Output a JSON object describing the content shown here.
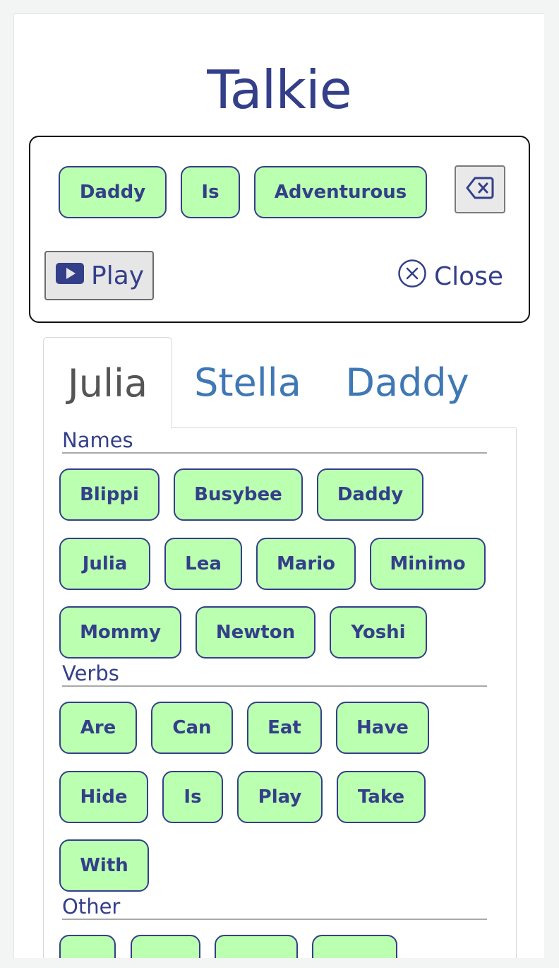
{
  "app": {
    "title": "Talkie"
  },
  "sentence": {
    "words": [
      "Daddy",
      "Is",
      "Adventurous"
    ],
    "backspace_icon": "backspace-icon",
    "play_label": "Play",
    "play_icon": "play-icon",
    "close_label": "Close",
    "close_icon": "close-circle-icon"
  },
  "tabs": [
    {
      "label": "Julia",
      "active": true
    },
    {
      "label": "Stella",
      "active": false
    },
    {
      "label": "Daddy",
      "active": false
    }
  ],
  "sections": [
    {
      "heading": "Names",
      "words": [
        "Blippi",
        "Busybee",
        "Daddy",
        "Julia",
        "Lea",
        "Mario",
        "Minimo",
        "Mommy",
        "Newton",
        "Yoshi"
      ]
    },
    {
      "heading": "Verbs",
      "words": [
        "Are",
        "Can",
        "Eat",
        "Have",
        "Hide",
        "Is",
        "Play",
        "Take",
        "With"
      ]
    },
    {
      "heading": "Other",
      "words": []
    }
  ],
  "colors": {
    "accent": "#343f8a",
    "chip_bg": "#bbffb0",
    "tab_link": "#3f78b4",
    "tab_active_text": "#555555"
  }
}
